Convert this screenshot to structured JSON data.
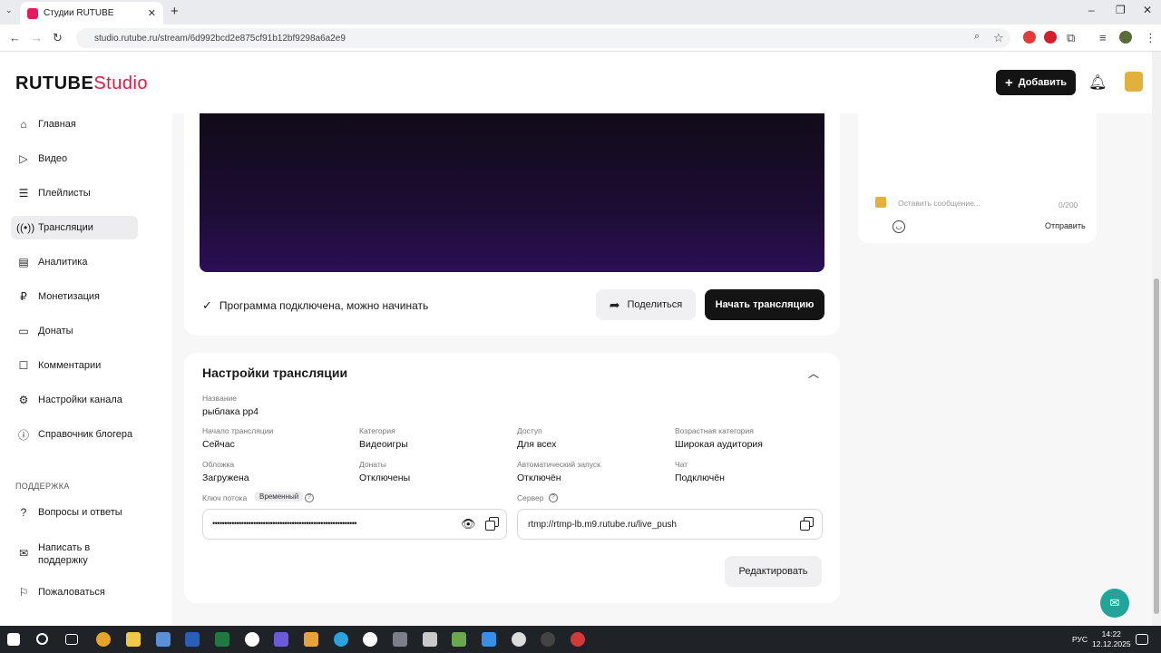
{
  "browser": {
    "tab_title": "Студии RUTUBE",
    "url": "studio.rutube.ru/stream/6d992bcd2e875cf91b12bf9298a6a2e9"
  },
  "header": {
    "logo_main": "RUTUBE",
    "logo_studio": "Studio",
    "add_label": "Добавить"
  },
  "sidebar": {
    "items": [
      {
        "label": "Главная",
        "icon": "home-icon"
      },
      {
        "label": "Видео",
        "icon": "video-icon"
      },
      {
        "label": "Плейлисты",
        "icon": "playlist-icon"
      },
      {
        "label": "Трансляции",
        "icon": "broadcast-icon"
      },
      {
        "label": "Аналитика",
        "icon": "analytics-icon"
      },
      {
        "label": "Монетизация",
        "icon": "ruble-icon"
      },
      {
        "label": "Донаты",
        "icon": "donate-icon"
      },
      {
        "label": "Комментарии",
        "icon": "comments-icon"
      },
      {
        "label": "Настройки канала",
        "icon": "gear-icon"
      },
      {
        "label": "Справочник блогера",
        "icon": "info-icon"
      }
    ],
    "support_title": "ПОДДЕРЖКА",
    "support_items": [
      {
        "label": "Вопросы и ответы"
      },
      {
        "label": "Написать в поддержку"
      },
      {
        "label": "Пожаловаться"
      }
    ]
  },
  "stream": {
    "status": "Программа подключена, можно начинать",
    "share_label": "Поделиться",
    "start_label": "Начать трансляцию"
  },
  "settings": {
    "title": "Настройки трансляции",
    "name_label": "Название",
    "name_value": "рыблака рр4",
    "fields": [
      {
        "label": "Начало трансляции",
        "value": "Сейчас"
      },
      {
        "label": "Категория",
        "value": "Видеоигры"
      },
      {
        "label": "Доступ",
        "value": "Для всех"
      },
      {
        "label": "Возрастная категория",
        "value": "Широкая аудитория"
      },
      {
        "label": "Обложка",
        "value": "Загружена"
      },
      {
        "label": "Донаты",
        "value": "Отключены"
      },
      {
        "label": "Автоматический запуск",
        "value": "Отключён"
      },
      {
        "label": "Чат",
        "value": "Подключён"
      }
    ],
    "key_label": "Ключ потока",
    "key_badge": "Временный",
    "key_value": "••••••••••••••••••••••••••••••••••••••••••••••••••••••••••••",
    "server_label": "Сервер",
    "server_value": "rtmp://rtmp-lb.m9.rutube.ru/live_push",
    "edit_label": "Редактировать"
  },
  "chat": {
    "placeholder": "Оставить сообщение...",
    "counter": "0/200",
    "send_label": "Отправить"
  },
  "taskbar": {
    "lang": "РУС",
    "time": "14:22",
    "date": "12.12.2025"
  },
  "colors": {
    "brand": "#ed143d",
    "dark_button": "#141414",
    "support_fab": "#22a49a"
  }
}
